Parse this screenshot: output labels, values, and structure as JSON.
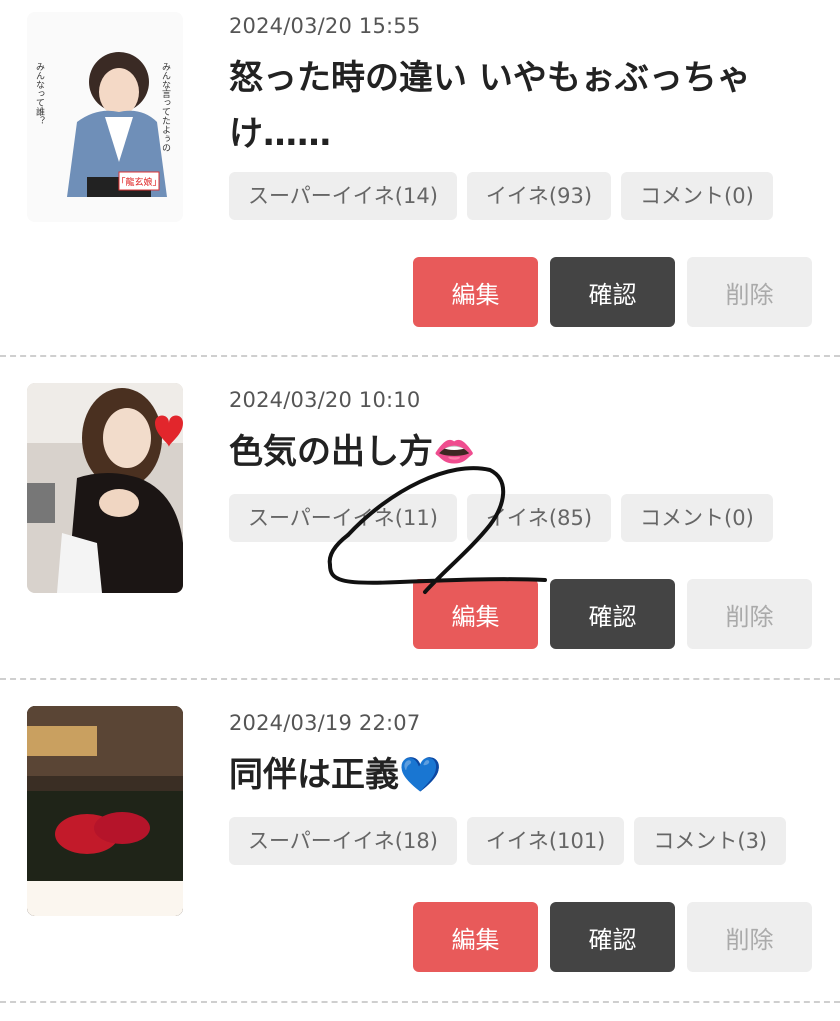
{
  "posts": [
    {
      "date": "2024/03/20 15:55",
      "title_line1": "怒った時の違い いやもぉぶっちゃ",
      "title_line2": "け……",
      "chips": [
        "スーパーイイネ(14)",
        "イイネ(93)",
        "コメント(0)"
      ],
      "buttons": {
        "edit": "編集",
        "confirm": "確認",
        "delete": "削除"
      },
      "thumb_texts": [
        "みんな言ってたよぅの",
        "みんなって誰？",
        "「龍玄娘」"
      ]
    },
    {
      "date": "2024/03/20 10:10",
      "title_line1": "色気の出し方👄",
      "chips": [
        "スーパーイイネ(11)",
        "イイネ(85)",
        "コメント(0)"
      ],
      "buttons": {
        "edit": "編集",
        "confirm": "確認",
        "delete": "削除"
      }
    },
    {
      "date": "2024/03/19 22:07",
      "title_line1": "同伴は正義💙",
      "chips": [
        "スーパーイイネ(18)",
        "イイネ(101)",
        "コメント(3)"
      ],
      "buttons": {
        "edit": "編集",
        "confirm": "確認",
        "delete": "削除"
      }
    }
  ],
  "colors": {
    "edit": "#e85a5a",
    "confirm": "#444444",
    "delete_bg": "#eeeeee",
    "chip_bg": "#eeeeee"
  }
}
